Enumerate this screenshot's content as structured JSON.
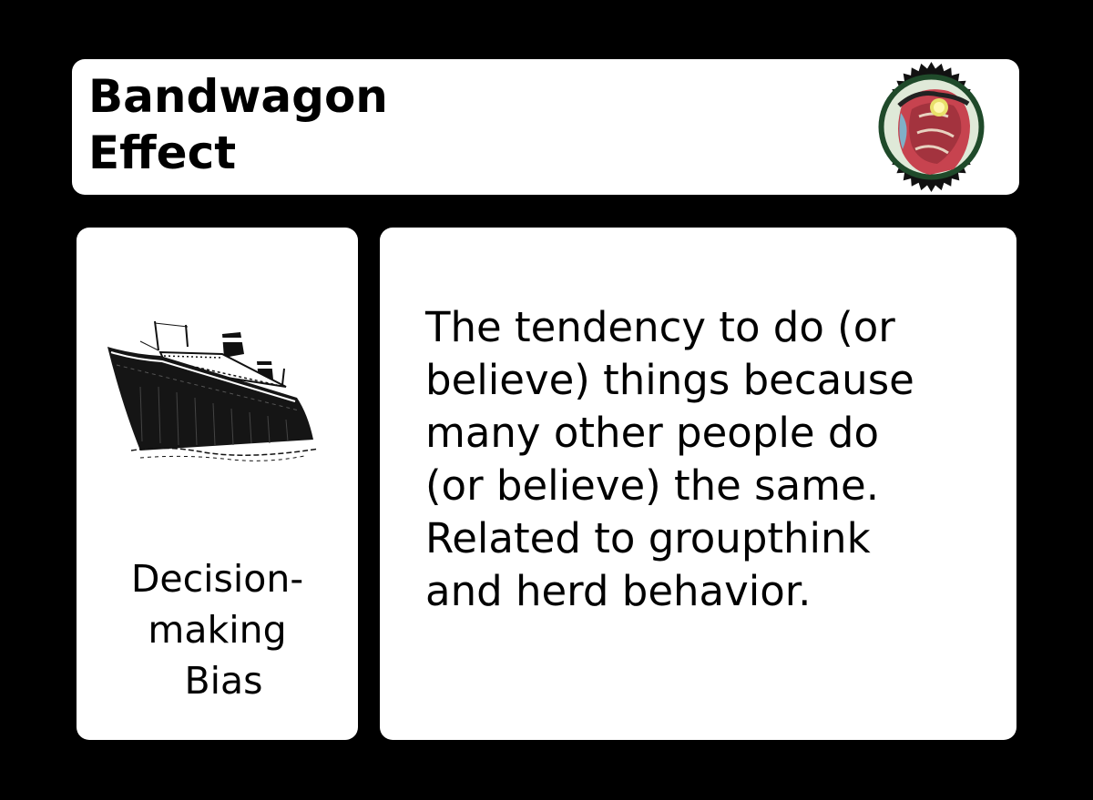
{
  "card": {
    "title_line1": "Bandwagon",
    "title_line2": "Effect",
    "seal_icon": "laurel-head-seal-icon",
    "illustration_icon": "ocean-liner-ship-icon",
    "category_line1": "Decision-",
    "category_line2": "making",
    "category_line3": "Bias",
    "description_lines": [
      "The tendency to do (or",
      "believe) things because",
      "many other people do",
      "(or believe) the same.",
      "Related to groupthink",
      "and herd behavior."
    ],
    "colors": {
      "background": "#000000",
      "panel": "#ffffff",
      "text": "#000000"
    }
  }
}
